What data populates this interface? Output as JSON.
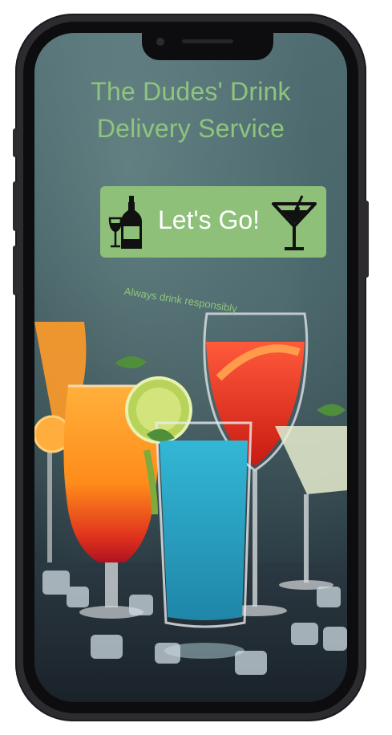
{
  "app": {
    "title_line1": "The Dudes' Drink",
    "title_line2": "Delivery Service"
  },
  "cta": {
    "label": "Let's Go!",
    "left_icon": "wine-bottle-and-glass-icon",
    "right_icon": "martini-glass-icon"
  },
  "tagline": "Always drink responsibly",
  "colors": {
    "accent": "#8ec07a",
    "title_text": "#8fc47d",
    "button_text": "#ffffff",
    "device_frame": "#2d2b30"
  }
}
